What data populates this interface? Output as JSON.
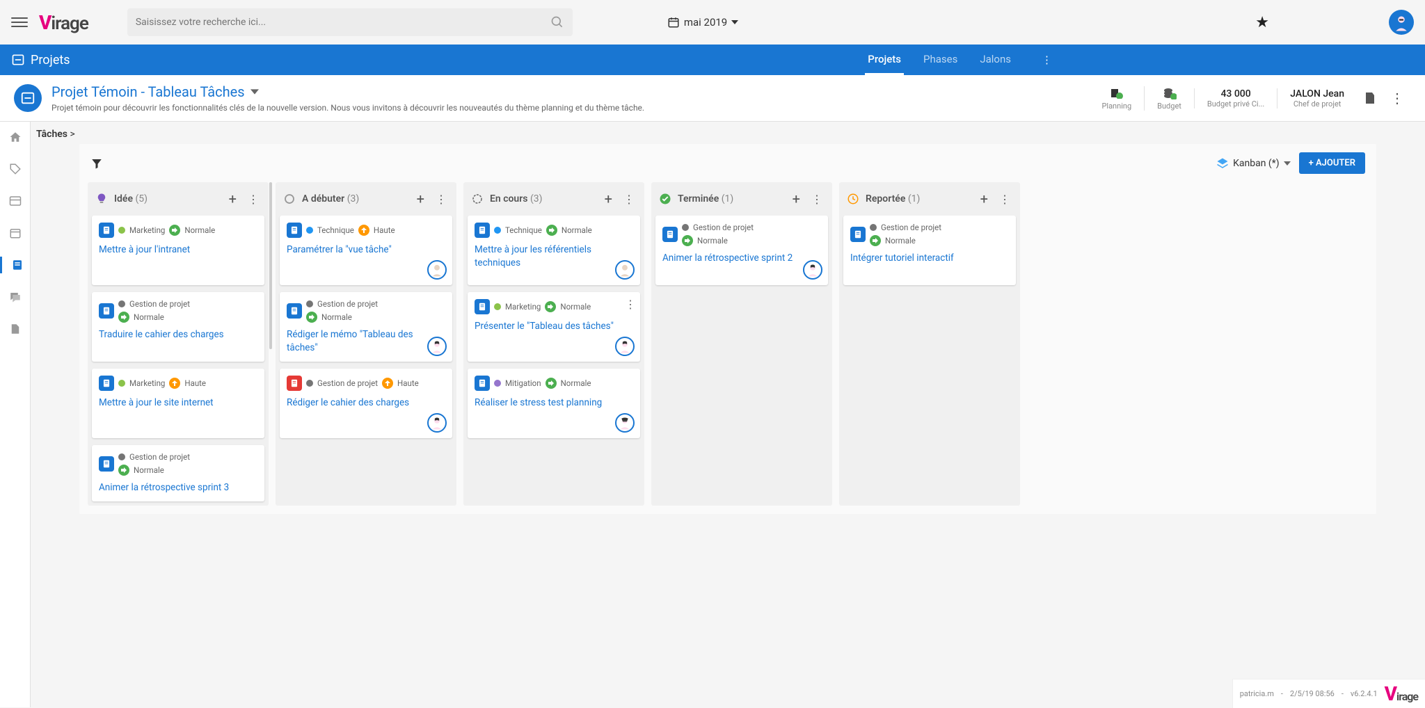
{
  "search": {
    "placeholder": "Saisissez votre recherche ici..."
  },
  "date": {
    "label": "mai 2019"
  },
  "nav": {
    "section": "Projets",
    "tabs": [
      "Projets",
      "Phases",
      "Jalons"
    ],
    "active": 0
  },
  "project": {
    "title": "Projet Témoin - Tableau Tâches",
    "desc": "Projet témoin pour découvrir les fonctionnalités clés de la nouvelle version. Nous vous invitons à découvrir les nouveautés du thème planning et du thème tâche.",
    "stats": {
      "planning": "Planning",
      "budget": "Budget",
      "budget_prive_val": "43 000",
      "budget_prive_label": "Budget privé Ci...",
      "chef_val": "JALON Jean",
      "chef_label": "Chef de projet"
    }
  },
  "breadcrumb": {
    "root": "Tâches",
    "sep": ">"
  },
  "board": {
    "view": "Kanban (*)",
    "add": "+ AJOUTER",
    "columns": [
      {
        "id": "idee",
        "title": "Idée",
        "count": "(5)",
        "iconColor": "#7e57c2",
        "cards": [
          {
            "icon": "blue",
            "tags": [
              {
                "dot": "#8bc34a",
                "text": "Marketing"
              }
            ],
            "prio": "green",
            "prioText": "Normale",
            "title": "Mettre à jour l'intranet",
            "tall": true
          },
          {
            "icon": "blue",
            "tagsWrap": true,
            "tags": [
              {
                "dot": "#757575",
                "text": "Gestion de projet"
              }
            ],
            "prio": "green",
            "prioText": "Normale",
            "title": "Traduire le cahier des charges",
            "tall": true
          },
          {
            "icon": "blue",
            "tags": [
              {
                "dot": "#8bc34a",
                "text": "Marketing"
              }
            ],
            "prio": "orange",
            "prioText": "Haute",
            "title": "Mettre à jour le site internet",
            "tall": true
          },
          {
            "icon": "blue",
            "tagsWrap": true,
            "tags": [
              {
                "dot": "#757575",
                "text": "Gestion de projet"
              }
            ],
            "prio": "green",
            "prioText": "Normale",
            "title": "Animer la rétrospective sprint 3"
          }
        ]
      },
      {
        "id": "adebuter",
        "title": "A débuter",
        "count": "(3)",
        "iconColor": "#999",
        "cards": [
          {
            "icon": "blue",
            "tags": [
              {
                "dot": "#2196f3",
                "text": "Technique"
              }
            ],
            "prio": "orange",
            "prioText": "Haute",
            "title": "Paramétrer la \"vue tâche\"",
            "avatar": "light",
            "tall": true
          },
          {
            "icon": "blue",
            "tagsWrap": true,
            "tags": [
              {
                "dot": "#757575",
                "text": "Gestion de projet"
              }
            ],
            "prio": "green",
            "prioText": "Normale",
            "title": "Rédiger le mémo \"Tableau des tâches\"",
            "avatar": "dark",
            "tall": true
          },
          {
            "icon": "red",
            "tags": [
              {
                "dot": "#757575",
                "text": "Gestion de projet"
              }
            ],
            "prio": "orange",
            "prioText": "Haute",
            "title": "Rédiger le cahier des charges",
            "avatar": "dark",
            "tall": true
          }
        ]
      },
      {
        "id": "encours",
        "title": "En cours",
        "count": "(3)",
        "iconColor": "#666",
        "cards": [
          {
            "icon": "blue",
            "tags": [
              {
                "dot": "#2196f3",
                "text": "Technique"
              }
            ],
            "prio": "green",
            "prioText": "Normale",
            "title": "Mettre à jour les référentiels techniques",
            "avatar": "light",
            "tall": true
          },
          {
            "icon": "blue",
            "tags": [
              {
                "dot": "#8bc34a",
                "text": "Marketing"
              }
            ],
            "prio": "green",
            "prioText": "Normale",
            "title": "Présenter le \"Tableau des tâches\"",
            "avatar": "dark",
            "tall": true,
            "more": true
          },
          {
            "icon": "blue",
            "tags": [
              {
                "dot": "#9575cd",
                "text": "Mitigation"
              }
            ],
            "prio": "green",
            "prioText": "Normale",
            "title": "Réaliser le stress test planning",
            "avatar": "glasses",
            "tall": true
          }
        ]
      },
      {
        "id": "terminee",
        "title": "Terminée",
        "count": "(1)",
        "iconColor": "#4caf50",
        "cards": [
          {
            "icon": "blue",
            "tagsWrap": true,
            "tags": [
              {
                "dot": "#757575",
                "text": "Gestion de projet"
              }
            ],
            "prio": "green",
            "prioText": "Normale",
            "title": "Animer la rétrospective sprint 2",
            "avatar": "dark",
            "tall": true
          }
        ]
      },
      {
        "id": "reportee",
        "title": "Reportée",
        "count": "(1)",
        "iconColor": "#ff9800",
        "cards": [
          {
            "icon": "blue",
            "tagsWrap": true,
            "tags": [
              {
                "dot": "#757575",
                "text": "Gestion de projet"
              }
            ],
            "prio": "green",
            "prioText": "Normale",
            "title": "Intégrer tutoriel interactif",
            "tall": true
          }
        ]
      }
    ]
  },
  "footer": {
    "user": "patricia.m",
    "datetime": "2/5/19 08:56",
    "version": "v6.2.4.1"
  }
}
